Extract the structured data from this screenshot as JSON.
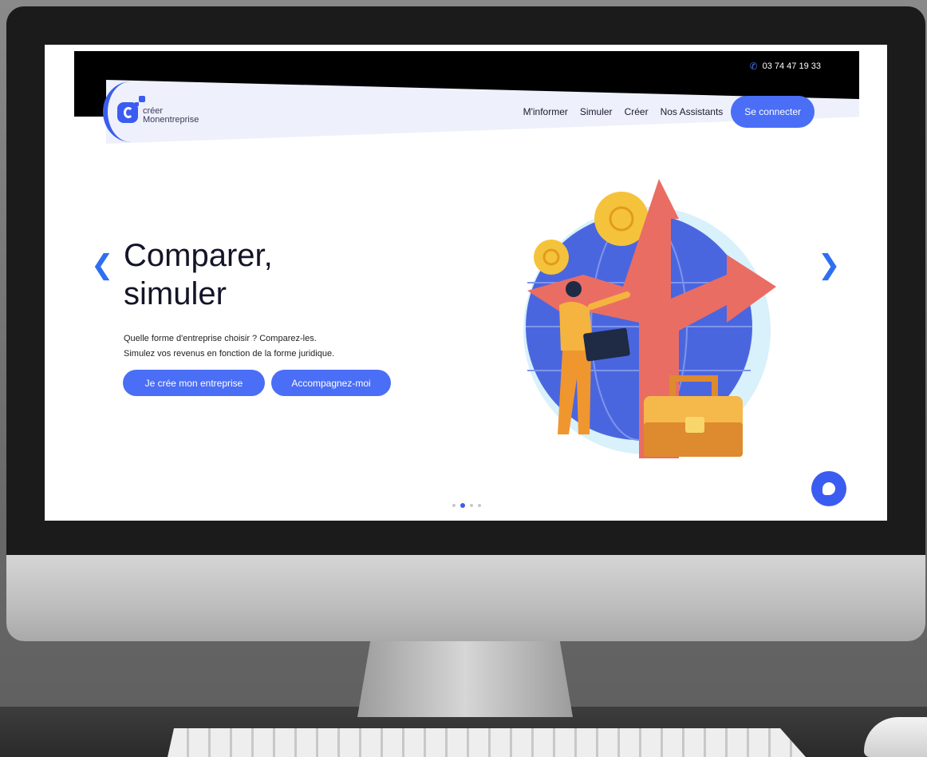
{
  "topbar": {
    "phone": "03 74 47 19 33"
  },
  "logo": {
    "line1": "créer",
    "line2": "Monentreprise"
  },
  "nav": {
    "items": [
      "M'informer",
      "Simuler",
      "Créer",
      "Nos Assistants"
    ],
    "connect_label": "Se connecter"
  },
  "hero": {
    "title_line1": "Comparer,",
    "title_line2": "simuler",
    "desc_line1": "Quelle forme d'entreprise choisir ? Comparez-les.",
    "desc_line2": "Simulez vos revenus en fonction de la forme juridique.",
    "primary_button": "Je crée mon entreprise",
    "secondary_button": "Accompagnez-moi"
  },
  "carousel": {
    "slide_count": 4,
    "active_index": 1
  },
  "colors": {
    "accent": "#4a6ef5",
    "arrow": "#2f6ef0",
    "topbar": "#000000"
  },
  "icons": [
    "phone-icon",
    "chevron-left-icon",
    "chevron-right-icon",
    "chat-icon"
  ]
}
